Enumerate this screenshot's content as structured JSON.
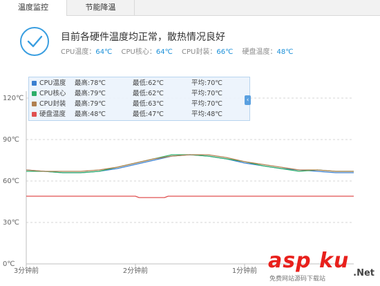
{
  "tabs": [
    {
      "label": "温度监控",
      "active": true
    },
    {
      "label": "节能降温",
      "active": false
    }
  ],
  "status": {
    "headline": "目前各硬件温度均正常，散热情况良好",
    "readings": [
      {
        "label": "CPU温度：",
        "value": "64℃"
      },
      {
        "label": "CPU核心：",
        "value": "64℃"
      },
      {
        "label": "CPU封装：",
        "value": "66℃"
      },
      {
        "label": "硬盘温度：",
        "value": "48℃"
      }
    ],
    "accent": "#1a8fd8"
  },
  "legend": [
    {
      "name": "CPU温度",
      "max": "最高:78℃",
      "min": "最低:62℃",
      "avg": "平均:70℃",
      "color": "#3a7fd0"
    },
    {
      "name": "CPU核心",
      "max": "最高:79℃",
      "min": "最低:62℃",
      "avg": "平均:70℃",
      "color": "#2eae6a"
    },
    {
      "name": "CPU封装",
      "max": "最高:79℃",
      "min": "最低:63℃",
      "avg": "平均:70℃",
      "color": "#b08050"
    },
    {
      "name": "硬盘温度",
      "max": "最高:48℃",
      "min": "最低:47℃",
      "avg": "平均:48℃",
      "color": "#e05050"
    }
  ],
  "chart_data": {
    "type": "line",
    "yticks": [
      "0℃",
      "30℃",
      "60℃",
      "90℃",
      "120℃"
    ],
    "ylim": [
      0,
      120
    ],
    "xticks": [
      "3分钟前",
      "2分钟前",
      "1分钟前"
    ],
    "xlim": [
      0,
      90
    ],
    "xtick_positions": [
      0,
      30,
      60
    ],
    "grid": "horizontal-dashed",
    "legend_position": "top-left",
    "series": [
      {
        "name": "CPU温度",
        "color": "#3a7fd0",
        "points": [
          [
            0,
            68
          ],
          [
            5,
            67
          ],
          [
            10,
            66
          ],
          [
            15,
            66
          ],
          [
            20,
            67
          ],
          [
            25,
            69
          ],
          [
            30,
            72
          ],
          [
            35,
            75
          ],
          [
            40,
            78
          ],
          [
            45,
            79
          ],
          [
            50,
            78
          ],
          [
            55,
            76
          ],
          [
            60,
            73
          ],
          [
            65,
            71
          ],
          [
            70,
            69
          ],
          [
            75,
            68
          ],
          [
            80,
            67
          ],
          [
            85,
            66
          ],
          [
            90,
            66
          ]
        ]
      },
      {
        "name": "CPU核心",
        "color": "#2eae6a",
        "points": [
          [
            0,
            67
          ],
          [
            5,
            67
          ],
          [
            10,
            66
          ],
          [
            15,
            66
          ],
          [
            20,
            67
          ],
          [
            25,
            70
          ],
          [
            30,
            73
          ],
          [
            35,
            76
          ],
          [
            40,
            79
          ],
          [
            45,
            79
          ],
          [
            50,
            78
          ],
          [
            55,
            76
          ],
          [
            60,
            74
          ],
          [
            65,
            71
          ],
          [
            70,
            69
          ],
          [
            75,
            67
          ],
          [
            80,
            68
          ],
          [
            85,
            67
          ],
          [
            90,
            67
          ]
        ]
      },
      {
        "name": "CPU封装",
        "color": "#b08050",
        "points": [
          [
            0,
            68
          ],
          [
            5,
            67
          ],
          [
            10,
            67
          ],
          [
            15,
            67
          ],
          [
            20,
            68
          ],
          [
            25,
            70
          ],
          [
            30,
            73
          ],
          [
            35,
            76
          ],
          [
            40,
            78
          ],
          [
            45,
            79
          ],
          [
            50,
            79
          ],
          [
            55,
            77
          ],
          [
            60,
            74
          ],
          [
            65,
            72
          ],
          [
            70,
            70
          ],
          [
            75,
            68
          ],
          [
            80,
            68
          ],
          [
            85,
            67
          ],
          [
            90,
            67
          ]
        ]
      },
      {
        "name": "硬盘温度",
        "color": "#e05050",
        "points": [
          [
            0,
            49
          ],
          [
            30,
            49
          ],
          [
            31,
            48
          ],
          [
            38,
            48
          ],
          [
            39,
            49
          ],
          [
            90,
            49
          ]
        ]
      }
    ]
  },
  "watermark": {
    "big": "asp ku",
    "net": ".Net",
    "sub": "免费网站源码下载站"
  }
}
